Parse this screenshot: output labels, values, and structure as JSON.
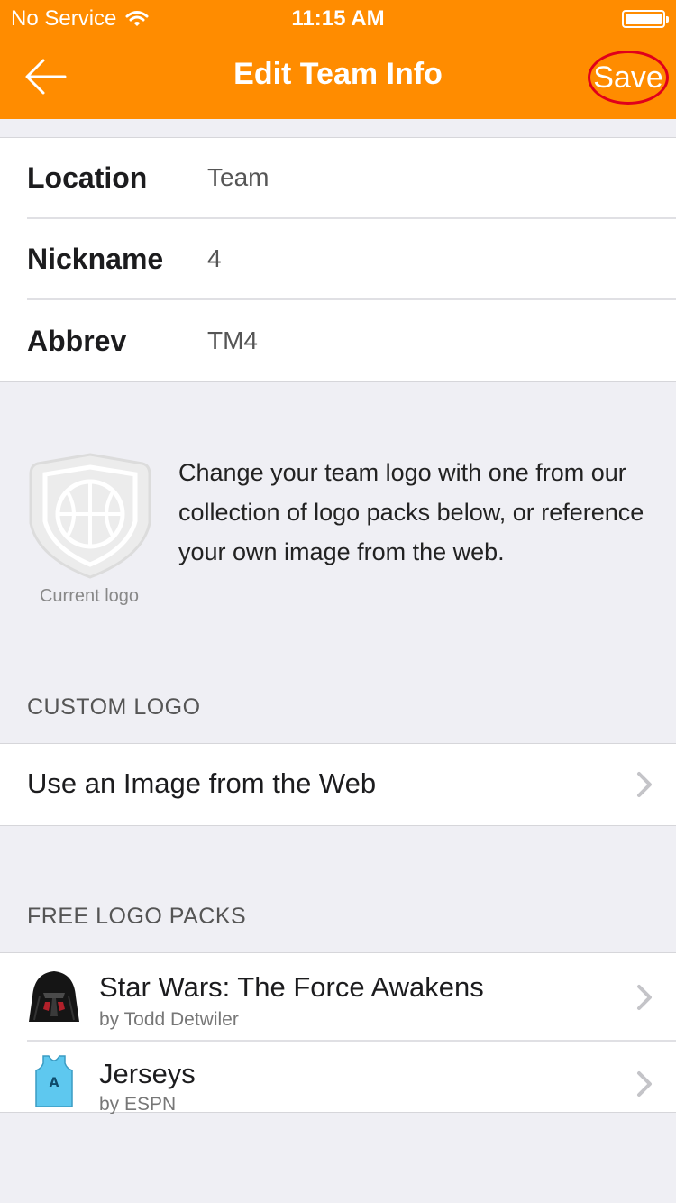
{
  "status_bar": {
    "carrier": "No Service",
    "time": "11:15 AM"
  },
  "nav": {
    "title": "Edit Team Info",
    "save_label": "Save"
  },
  "form": {
    "rows": [
      {
        "label": "Location",
        "value": "Team"
      },
      {
        "label": "Nickname",
        "value": "4"
      },
      {
        "label": "Abbrev",
        "value": "TM4"
      }
    ]
  },
  "logo": {
    "caption": "Current logo",
    "description": "Change your team logo with one from our collection of logo packs below, or reference your own image from the web."
  },
  "custom_logo": {
    "header": "CUSTOM LOGO",
    "item_label": "Use an Image from the Web"
  },
  "free_packs": {
    "header": "FREE LOGO PACKS",
    "items": [
      {
        "title": "Star Wars: The Force Awakens",
        "author": "by Todd Detwiler",
        "icon": "kylo-ren-helmet-icon"
      },
      {
        "title": "Jerseys",
        "author": "by ESPN",
        "icon": "jersey-icon",
        "jersey_letter": "A"
      }
    ]
  },
  "colors": {
    "accent": "#ff8c00",
    "highlight_circle": "#e0001b",
    "jersey": "#5ec8ef"
  }
}
